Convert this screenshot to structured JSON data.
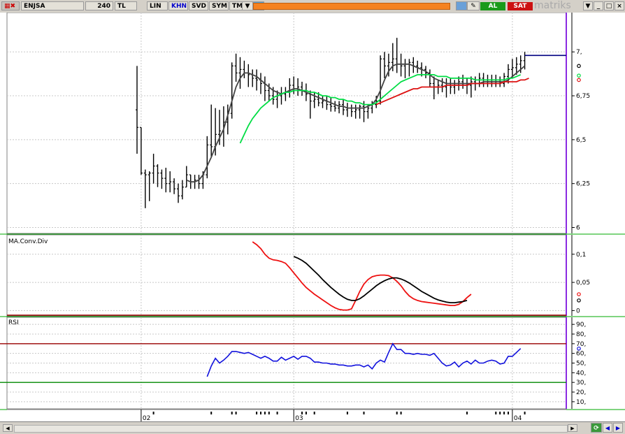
{
  "toolbar": {
    "symbol": "ENJSA",
    "period": "240",
    "currency": "TL",
    "scale": "LIN",
    "chart_type": "KHN",
    "buttons": [
      "SVD",
      "SYM",
      "TMP"
    ],
    "buy_label": "AL",
    "sell_label": "SAT",
    "brand": "matriks"
  },
  "colors": {
    "price": "#000000",
    "ma_short": "#444444",
    "ma_mid": "#00dd44",
    "ma_long": "#dd1111",
    "macd_line": "#000000",
    "macd_signal": "#ee1111",
    "rsi_line": "#1111dd",
    "rsi_upper": "#990000",
    "rsi_lower": "#008800",
    "last_price_line": "#000080"
  },
  "chart_data": [
    {
      "type": "ohlc",
      "panel": "price",
      "y_ticks": [
        6,
        6.25,
        6.5,
        6.75,
        7
      ],
      "y_tick_labels": [
        "6",
        "6,25",
        "6,5",
        "6,75",
        "7,"
      ],
      "ylim": [
        5.99,
        7.2
      ],
      "x_tick_labels": [
        "02",
        "03",
        "04"
      ],
      "x_tick_bars": [
        1,
        38,
        91
      ],
      "bars": [
        [
          6.67,
          6.92,
          6.42,
          6.57
        ],
        [
          6.57,
          6.57,
          6.3,
          6.31
        ],
        [
          6.31,
          6.33,
          6.11,
          6.3
        ],
        [
          6.3,
          6.32,
          6.15,
          6.31
        ],
        [
          6.31,
          6.42,
          6.25,
          6.35
        ],
        [
          6.35,
          6.36,
          6.23,
          6.31
        ],
        [
          6.31,
          6.33,
          6.22,
          6.28
        ],
        [
          6.28,
          6.34,
          6.2,
          6.25
        ],
        [
          6.25,
          6.32,
          6.2,
          6.26
        ],
        [
          6.26,
          6.28,
          6.19,
          6.22
        ],
        [
          6.22,
          6.25,
          6.14,
          6.18
        ],
        [
          6.18,
          6.27,
          6.16,
          6.23
        ],
        [
          6.23,
          6.35,
          6.23,
          6.3
        ],
        [
          6.3,
          6.3,
          6.22,
          6.26
        ],
        [
          6.26,
          6.3,
          6.22,
          6.27
        ],
        [
          6.27,
          6.3,
          6.22,
          6.25
        ],
        [
          6.25,
          6.32,
          6.22,
          6.3
        ],
        [
          6.3,
          6.52,
          6.28,
          6.47
        ],
        [
          6.47,
          6.7,
          6.4,
          6.46
        ],
        [
          6.46,
          6.68,
          6.41,
          6.53
        ],
        [
          6.53,
          6.67,
          6.47,
          6.55
        ],
        [
          6.55,
          6.69,
          6.46,
          6.6
        ],
        [
          6.6,
          6.7,
          6.53,
          6.65
        ],
        [
          6.65,
          6.94,
          6.62,
          6.92
        ],
        [
          6.92,
          6.99,
          6.83,
          6.88
        ],
        [
          6.88,
          6.97,
          6.79,
          6.9
        ],
        [
          6.9,
          6.95,
          6.85,
          6.88
        ],
        [
          6.88,
          6.93,
          6.8,
          6.87
        ],
        [
          6.87,
          6.9,
          6.8,
          6.85
        ],
        [
          6.85,
          6.9,
          6.78,
          6.84
        ],
        [
          6.84,
          6.88,
          6.76,
          6.82
        ],
        [
          6.82,
          6.86,
          6.72,
          6.78
        ],
        [
          6.78,
          6.82,
          6.72,
          6.75
        ],
        [
          6.75,
          6.8,
          6.7,
          6.73
        ],
        [
          6.73,
          6.78,
          6.68,
          6.75
        ],
        [
          6.75,
          6.8,
          6.7,
          6.76
        ],
        [
          6.76,
          6.8,
          6.72,
          6.77
        ],
        [
          6.77,
          6.85,
          6.74,
          6.81
        ],
        [
          6.81,
          6.86,
          6.76,
          6.79
        ],
        [
          6.79,
          6.85,
          6.75,
          6.8
        ],
        [
          6.8,
          6.83,
          6.75,
          6.78
        ],
        [
          6.78,
          6.82,
          6.72,
          6.76
        ],
        [
          6.76,
          6.78,
          6.62,
          6.72
        ],
        [
          6.72,
          6.77,
          6.68,
          6.73
        ],
        [
          6.73,
          6.77,
          6.69,
          6.71
        ],
        [
          6.71,
          6.75,
          6.68,
          6.72
        ],
        [
          6.72,
          6.75,
          6.67,
          6.7
        ],
        [
          6.7,
          6.74,
          6.66,
          6.69
        ],
        [
          6.69,
          6.72,
          6.66,
          6.68
        ],
        [
          6.68,
          6.72,
          6.65,
          6.7
        ],
        [
          6.7,
          6.73,
          6.64,
          6.67
        ],
        [
          6.67,
          6.71,
          6.63,
          6.68
        ],
        [
          6.68,
          6.7,
          6.63,
          6.66
        ],
        [
          6.66,
          6.7,
          6.62,
          6.67
        ],
        [
          6.67,
          6.7,
          6.62,
          6.69
        ],
        [
          6.69,
          6.72,
          6.6,
          6.66
        ],
        [
          6.66,
          6.7,
          6.62,
          6.68
        ],
        [
          6.68,
          6.72,
          6.65,
          6.7
        ],
        [
          6.7,
          6.75,
          6.68,
          6.72
        ],
        [
          6.72,
          6.98,
          6.7,
          6.96
        ],
        [
          6.96,
          7.0,
          6.85,
          6.92
        ],
        [
          6.92,
          6.99,
          6.86,
          6.94
        ],
        [
          6.94,
          7.05,
          6.89,
          6.96
        ],
        [
          6.96,
          7.08,
          6.88,
          6.93
        ],
        [
          6.93,
          6.99,
          6.86,
          6.92
        ],
        [
          6.92,
          6.96,
          6.85,
          6.93
        ],
        [
          6.93,
          6.96,
          6.86,
          6.94
        ],
        [
          6.94,
          6.97,
          6.88,
          6.92
        ],
        [
          6.92,
          6.95,
          6.88,
          6.91
        ],
        [
          6.91,
          6.94,
          6.86,
          6.9
        ],
        [
          6.9,
          6.92,
          6.85,
          6.88
        ],
        [
          6.88,
          6.9,
          6.8,
          6.82
        ],
        [
          6.82,
          6.86,
          6.73,
          6.8
        ],
        [
          6.8,
          6.84,
          6.76,
          6.81
        ],
        [
          6.81,
          6.85,
          6.77,
          6.8
        ],
        [
          6.8,
          6.85,
          6.74,
          6.82
        ],
        [
          6.82,
          6.85,
          6.76,
          6.8
        ],
        [
          6.8,
          6.84,
          6.76,
          6.82
        ],
        [
          6.82,
          6.86,
          6.78,
          6.83
        ],
        [
          6.83,
          6.87,
          6.79,
          6.82
        ],
        [
          6.82,
          6.85,
          6.76,
          6.81
        ],
        [
          6.81,
          6.86,
          6.74,
          6.83
        ],
        [
          6.83,
          6.86,
          6.78,
          6.82
        ],
        [
          6.82,
          6.88,
          6.8,
          6.85
        ],
        [
          6.85,
          6.88,
          6.8,
          6.84
        ],
        [
          6.84,
          6.87,
          6.8,
          6.83
        ],
        [
          6.83,
          6.87,
          6.8,
          6.84
        ],
        [
          6.84,
          6.87,
          6.8,
          6.83
        ],
        [
          6.83,
          6.86,
          6.8,
          6.82
        ],
        [
          6.82,
          6.88,
          6.8,
          6.86
        ],
        [
          6.86,
          6.93,
          6.82,
          6.9
        ],
        [
          6.9,
          6.96,
          6.85,
          6.91
        ],
        [
          6.91,
          6.97,
          6.87,
          6.93
        ],
        [
          6.93,
          6.98,
          6.88,
          6.95
        ],
        [
          6.95,
          7.0,
          6.9,
          6.98
        ]
      ],
      "last_value": 6.98,
      "moving_averages": [
        {
          "color_key": "ma_short",
          "start_bar": 12,
          "values": [
            6.27,
            6.26,
            6.26,
            6.27,
            6.3,
            6.35,
            6.4,
            6.46,
            6.51,
            6.56,
            6.64,
            6.72,
            6.8,
            6.85,
            6.88,
            6.88,
            6.87,
            6.86,
            6.84,
            6.82,
            6.8,
            6.78,
            6.77,
            6.76,
            6.77,
            6.78,
            6.79,
            6.79,
            6.78,
            6.77,
            6.76,
            6.75,
            6.74,
            6.73,
            6.72,
            6.71,
            6.7,
            6.69,
            6.69,
            6.68,
            6.68,
            6.68,
            6.68,
            6.68,
            6.69,
            6.7,
            6.73,
            6.78,
            6.84,
            6.89,
            6.92,
            6.93,
            6.93,
            6.93,
            6.93,
            6.92,
            6.91,
            6.9,
            6.89,
            6.87,
            6.85,
            6.84,
            6.83,
            6.82,
            6.82,
            6.82,
            6.82,
            6.82,
            6.82,
            6.82,
            6.82,
            6.82,
            6.83,
            6.83,
            6.83,
            6.83,
            6.83,
            6.83,
            6.84,
            6.86,
            6.88,
            6.9,
            6.92
          ]
        },
        {
          "color_key": "ma_mid",
          "start_bar": 25,
          "values": [
            6.48,
            6.53,
            6.58,
            6.62,
            6.65,
            6.68,
            6.7,
            6.72,
            6.74,
            6.75,
            6.76,
            6.77,
            6.77,
            6.78,
            6.78,
            6.78,
            6.78,
            6.77,
            6.77,
            6.76,
            6.75,
            6.75,
            6.74,
            6.74,
            6.73,
            6.73,
            6.72,
            6.72,
            6.71,
            6.71,
            6.7,
            6.7,
            6.7,
            6.71,
            6.73,
            6.75,
            6.77,
            6.79,
            6.81,
            6.83,
            6.84,
            6.85,
            6.86,
            6.87,
            6.87,
            6.87,
            6.87,
            6.87,
            6.86,
            6.86,
            6.86,
            6.85,
            6.85,
            6.85,
            6.85,
            6.85,
            6.85,
            6.84,
            6.84,
            6.84,
            6.84,
            6.84,
            6.84,
            6.84,
            6.84,
            6.85,
            6.85,
            6.86,
            6.87
          ]
        },
        {
          "color_key": "ma_long",
          "start_bar": 58,
          "values": [
            6.7,
            6.71,
            6.72,
            6.73,
            6.74,
            6.75,
            6.76,
            6.77,
            6.78,
            6.79,
            6.79,
            6.8,
            6.8,
            6.8,
            6.8,
            6.8,
            6.8,
            6.81,
            6.81,
            6.81,
            6.81,
            6.81,
            6.81,
            6.82,
            6.82,
            6.82,
            6.82,
            6.82,
            6.82,
            6.82,
            6.82,
            6.83,
            6.83,
            6.83,
            6.83,
            6.84,
            6.84,
            6.85
          ]
        }
      ]
    },
    {
      "type": "line",
      "panel": "macd",
      "title": "MA.Conv.Div",
      "y_ticks": [
        0,
        0.05,
        0.1
      ],
      "y_tick_labels": [
        "0",
        "0,05",
        "0,1"
      ],
      "ylim": [
        -0.002,
        0.127
      ],
      "series": [
        {
          "color_key": "macd_signal",
          "start_bar": 28,
          "values": [
            0.122,
            0.117,
            0.11,
            0.1,
            0.093,
            0.09,
            0.089,
            0.087,
            0.084,
            0.076,
            0.067,
            0.058,
            0.049,
            0.041,
            0.035,
            0.029,
            0.024,
            0.019,
            0.014,
            0.009,
            0.005,
            0.002,
            0.001,
            0.001,
            0.003,
            0.018,
            0.034,
            0.047,
            0.055,
            0.06,
            0.062,
            0.063,
            0.063,
            0.062,
            0.058,
            0.052,
            0.044,
            0.034,
            0.026,
            0.021,
            0.018,
            0.016,
            0.015,
            0.014,
            0.013,
            0.012,
            0.011,
            0.01,
            0.009,
            0.009,
            0.011,
            0.016,
            0.023,
            0.029
          ]
        },
        {
          "color_key": "macd_line",
          "start_bar": 38,
          "values": [
            0.096,
            0.093,
            0.089,
            0.084,
            0.077,
            0.07,
            0.063,
            0.055,
            0.048,
            0.041,
            0.035,
            0.029,
            0.024,
            0.02,
            0.018,
            0.018,
            0.021,
            0.026,
            0.032,
            0.038,
            0.044,
            0.049,
            0.053,
            0.056,
            0.058,
            0.058,
            0.056,
            0.053,
            0.049,
            0.044,
            0.039,
            0.034,
            0.03,
            0.026,
            0.022,
            0.019,
            0.017,
            0.015,
            0.014,
            0.014,
            0.015,
            0.016,
            0.018
          ]
        }
      ]
    },
    {
      "type": "line",
      "panel": "rsi",
      "title": "RSI",
      "y_ticks": [
        10,
        20,
        30,
        40,
        50,
        60,
        70,
        80,
        90
      ],
      "y_tick_labels": [
        "10,",
        "20,",
        "30,",
        "40,",
        "50,",
        "60,",
        "70,",
        "80,",
        "90,"
      ],
      "ylim": [
        7,
        93
      ],
      "upper_level": 70,
      "lower_level": 30,
      "series": [
        {
          "color_key": "rsi_line",
          "start_bar": 17,
          "values": [
            36,
            47,
            55,
            50,
            53,
            57,
            62,
            62,
            61,
            60,
            61,
            59,
            57,
            55,
            57,
            55,
            52,
            52,
            56,
            53,
            55,
            57,
            54,
            57,
            57,
            55,
            51,
            51,
            50,
            50,
            49,
            49,
            48,
            48,
            47,
            47,
            48,
            48,
            46,
            48,
            44,
            50,
            53,
            51,
            61,
            70,
            64,
            64,
            60,
            60,
            59,
            60,
            59,
            59,
            58,
            60,
            55,
            50,
            47,
            48,
            51,
            46,
            50,
            52,
            49,
            53,
            50,
            50,
            52,
            53,
            52,
            49,
            50,
            57,
            57,
            61,
            65
          ]
        }
      ]
    }
  ]
}
